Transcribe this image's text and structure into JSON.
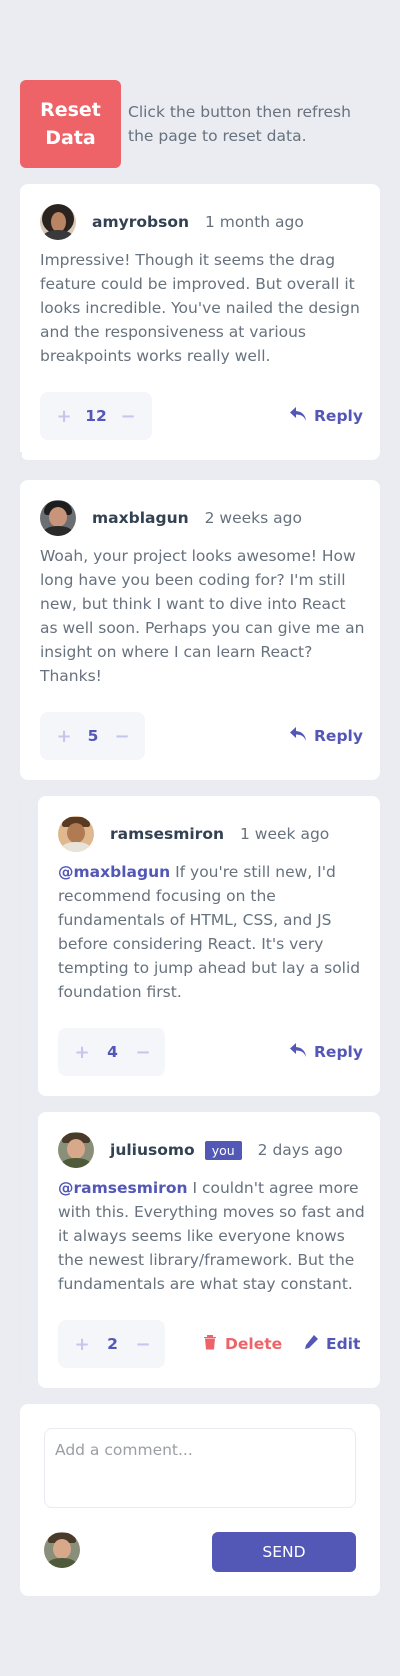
{
  "reset": {
    "button_label": "Reset Data",
    "hint": "Click the button then refresh the page to reset data."
  },
  "colors": {
    "accent": "#5357b6",
    "danger": "#ed6368",
    "background": "#eaecf1",
    "muted_text": "#67727e"
  },
  "comments": [
    {
      "username": "amyrobson",
      "time": "1 month ago",
      "mention": "",
      "text": "Impressive! Though it seems the drag feature could be improved. But overall it looks incredible. You've nailed the design and the responsiveness at various breakpoints works really well.",
      "score": "12",
      "reply_label": "Reply"
    },
    {
      "username": "maxblagun",
      "time": "2 weeks ago",
      "mention": "",
      "text": "Woah, your project looks awesome! How long have you been coding for? I'm still new, but think I want to dive into React as well soon. Perhaps you can give me an insight on where I can learn React? Thanks!",
      "score": "5",
      "reply_label": "Reply"
    }
  ],
  "replies": [
    {
      "username": "ramsesmiron",
      "time": "1 week ago",
      "mention": "@maxblagun",
      "text": " If you're still new, I'd recommend focusing on the fundamentals of HTML, CSS, and JS before considering React. It's very tempting to jump ahead but lay a solid foundation first.",
      "score": "4",
      "reply_label": "Reply"
    },
    {
      "username": "juliusomo",
      "you_badge": "you",
      "time": "2 days ago",
      "mention": "@ramsesmiron",
      "text": " I couldn't agree more with this. Everything moves so fast and it always seems like everyone knows the newest library/framework. But the fundamentals are what stay constant.",
      "score": "2",
      "delete_label": "Delete",
      "edit_label": "Edit"
    }
  ],
  "vote_controls": {
    "plus": "+",
    "minus": "−"
  },
  "new_comment": {
    "placeholder": "Add a comment...",
    "send_label": "SEND"
  },
  "icons": {
    "reply": "reply-arrow-icon",
    "delete": "trash-icon",
    "edit": "pencil-icon"
  }
}
